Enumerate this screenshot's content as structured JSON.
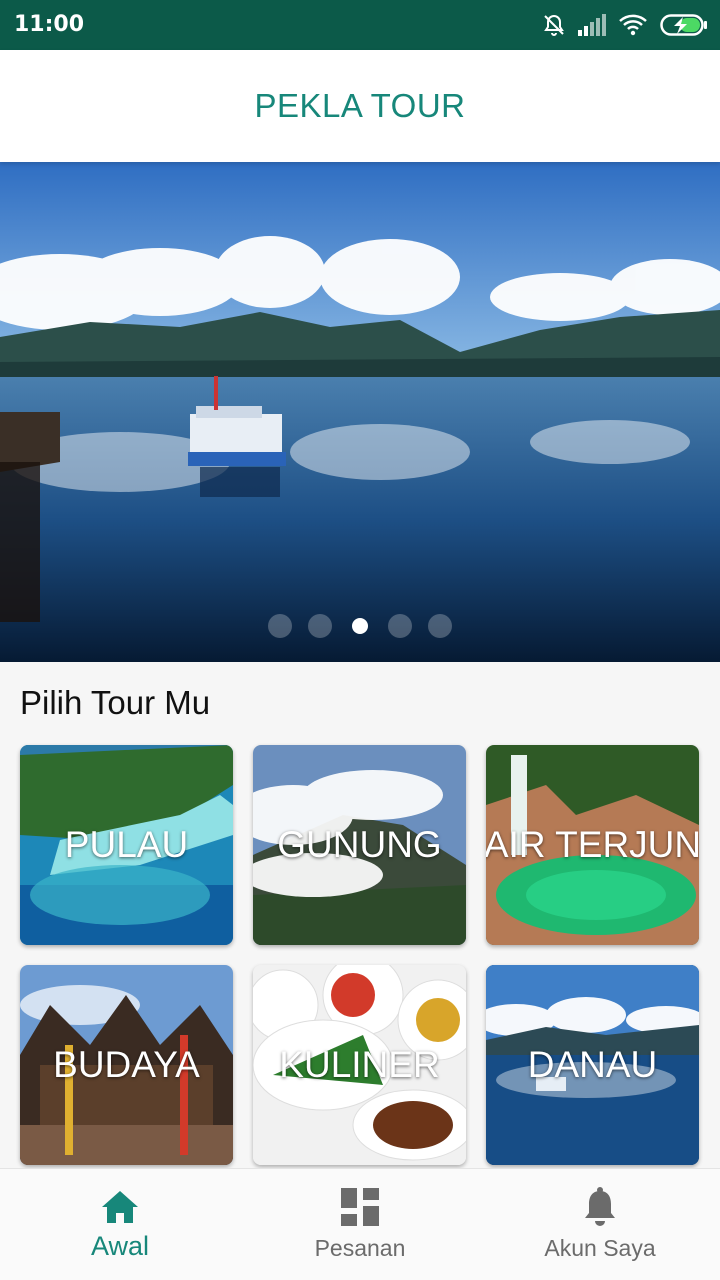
{
  "status_bar": {
    "time": "11:00",
    "icons": [
      "bell-off-icon",
      "signal-icon",
      "wifi-icon",
      "battery-charging-icon"
    ]
  },
  "app_bar": {
    "title": "PEKLA TOUR"
  },
  "carousel": {
    "slide_count": 5,
    "active_index": 2
  },
  "section": {
    "title": "Pilih Tour Mu"
  },
  "categories": [
    {
      "label": "PULAU"
    },
    {
      "label": "GUNUNG"
    },
    {
      "label": "AIR TERJUN"
    },
    {
      "label": "BUDAYA"
    },
    {
      "label": "KULINER"
    },
    {
      "label": "DANAU"
    }
  ],
  "bottom_nav": {
    "items": [
      {
        "label": "Awal",
        "icon": "home-icon",
        "active": true
      },
      {
        "label": "Pesanan",
        "icon": "dashboard-icon",
        "active": false
      },
      {
        "label": "Akun Saya",
        "icon": "bell-icon",
        "active": false
      }
    ]
  },
  "colors": {
    "status_bar": "#0c5a49",
    "accent": "#17877a",
    "inactive": "#6b6b6b"
  }
}
